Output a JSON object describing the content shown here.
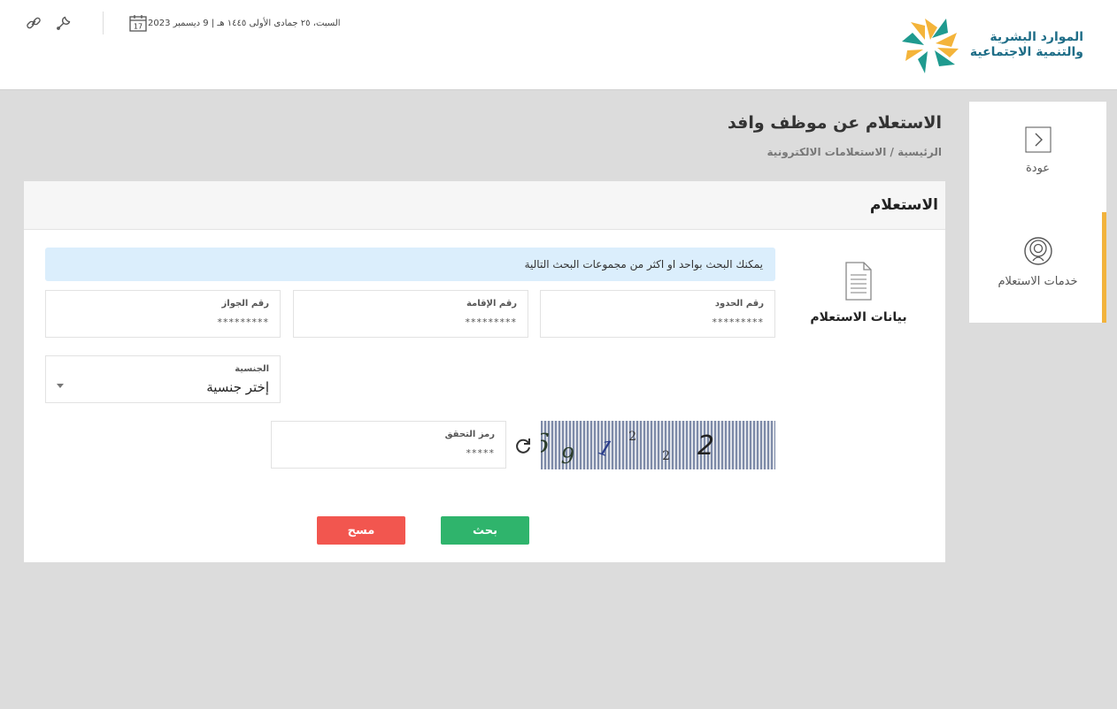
{
  "header": {
    "logo_line1": "الموارد البشرية",
    "logo_line2": "والتنمية الاجتماعية",
    "date": "السبت، ٢٥ جمادى الأولى ١٤٤٥ هـ | 9 ديسمبر 2023",
    "calendar_day": "17"
  },
  "side_menu": {
    "back_label": "عودة",
    "services_label": "خدمات الاستعلام"
  },
  "page": {
    "title": "الاستعلام عن موظف وافد",
    "breadcrumb": "الرئيسية / الاستعلامات الالكترونية"
  },
  "card": {
    "title": "الاستعلام",
    "section_label": "بيانات الاستعلام",
    "info_text": "يمكنك البحث بواحد او اكثر من مجموعات البحث التالية"
  },
  "fields": {
    "border_number": {
      "label": "رقم الحدود",
      "placeholder": "*********"
    },
    "iqama_number": {
      "label": "رقم الإقامة",
      "placeholder": "*********"
    },
    "passport_number": {
      "label": "رقم الجواز",
      "placeholder": "*********"
    },
    "nationality": {
      "label": "الجنسية",
      "value": "إختر جنسية"
    },
    "captcha": {
      "label": "رمز التحقق",
      "placeholder": "*****"
    }
  },
  "captcha_image": {
    "glyphs": [
      "6",
      "9",
      "1",
      "2",
      "2",
      "2"
    ]
  },
  "buttons": {
    "search": "بحث",
    "clear": "مسح"
  },
  "colors": {
    "primary_teal": "#1e6d87",
    "accent_yellow": "#f2b33d",
    "search_green": "#2fb46c",
    "clear_red": "#f2564f",
    "info_blue": "#dbeefc"
  }
}
